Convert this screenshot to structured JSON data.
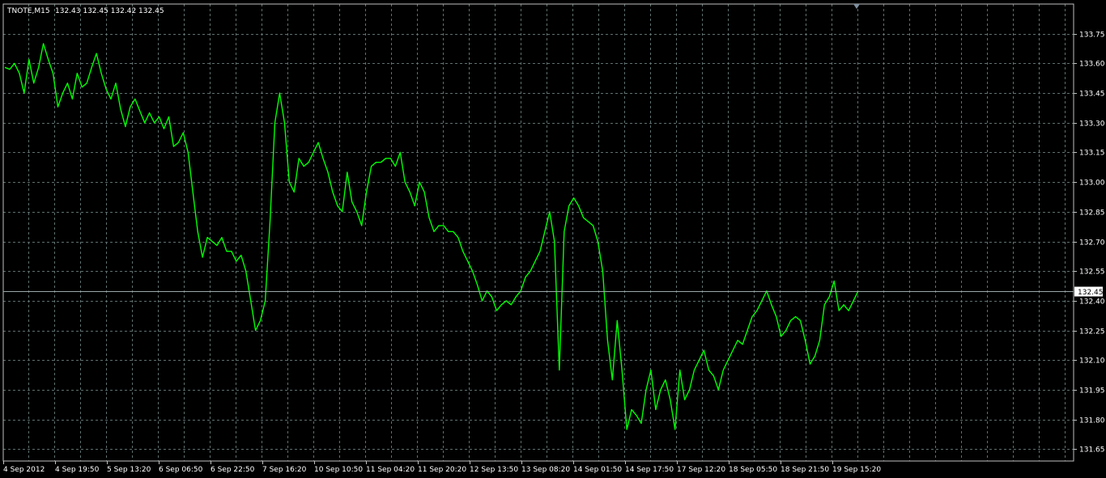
{
  "header": {
    "symbol_timeframe": "TNOTE,M15",
    "ohlc": "132.43 132.45 132.42 132.45"
  },
  "colors": {
    "background": "#000000",
    "grid": "#5f6f6f",
    "axis": "#c0c0c0",
    "price_line": "#00ff00",
    "current_price_line": "#9aa7a7",
    "current_price_label_bg": "#ffffff",
    "current_price_label_text": "#000000",
    "text": "#ffffff"
  },
  "chart_data": {
    "type": "line",
    "symbol": "TNOTE",
    "timeframe": "M15",
    "ylim": [
      131.59,
      133.9
    ],
    "yticks": [
      131.65,
      131.8,
      131.95,
      132.1,
      132.25,
      132.4,
      132.55,
      132.7,
      132.85,
      133.0,
      133.15,
      133.3,
      133.45,
      133.6,
      133.75
    ],
    "ytick_labels": [
      "131.65",
      "131.80",
      "131.95",
      "132.10",
      "132.25",
      "132.40",
      "132.55",
      "132.70",
      "132.85",
      "133.00",
      "133.15",
      "133.30",
      "133.45",
      "133.60",
      "133.75"
    ],
    "xtick_labels": [
      "4 Sep 2012",
      "4 Sep 19:50",
      "5 Sep 13:20",
      "6 Sep 06:50",
      "6 Sep 22:50",
      "7 Sep 16:20",
      "10 Sep 10:50",
      "11 Sep 04:20",
      "11 Sep 20:20",
      "12 Sep 13:50",
      "13 Sep 08:20",
      "14 Sep 01:50",
      "14 Sep 17:50",
      "17 Sep 12:20",
      "18 Sep 05:50",
      "18 Sep 21:50",
      "19 Sep 15:20"
    ],
    "grid": true,
    "current_price": 132.45,
    "current_price_label": "132.45",
    "series": [
      {
        "values": [
          133.58,
          133.57,
          133.6,
          133.55,
          133.45,
          133.62,
          133.5,
          133.58,
          133.7,
          133.62,
          133.55,
          133.38,
          133.45,
          133.5,
          133.42,
          133.55,
          133.48,
          133.5,
          133.58,
          133.65,
          133.55,
          133.47,
          133.42,
          133.5,
          133.37,
          133.28,
          133.38,
          133.42,
          133.36,
          133.3,
          133.35,
          133.3,
          133.33,
          133.27,
          133.33,
          133.18,
          133.2,
          133.25,
          133.15,
          132.95,
          132.75,
          132.62,
          132.72,
          132.7,
          132.68,
          132.72,
          132.65,
          132.65,
          132.6,
          132.63,
          132.55,
          132.4,
          132.25,
          132.3,
          132.4,
          132.8,
          133.3,
          133.45,
          133.3,
          133.0,
          132.95,
          133.12,
          133.08,
          133.1,
          133.15,
          133.2,
          133.12,
          133.05,
          132.95,
          132.88,
          132.85,
          133.05,
          132.9,
          132.85,
          132.78,
          132.95,
          133.08,
          133.1,
          133.1,
          133.12,
          133.12,
          133.08,
          133.15,
          133.0,
          132.95,
          132.88,
          133.0,
          132.95,
          132.82,
          132.75,
          132.78,
          132.78,
          132.75,
          132.75,
          132.72,
          132.65,
          132.6,
          132.55,
          132.48,
          132.4,
          132.45,
          132.42,
          132.35,
          132.38,
          132.4,
          132.38,
          132.42,
          132.45,
          132.52,
          132.55,
          132.6,
          132.65,
          132.75,
          132.85,
          132.7,
          132.05,
          132.75,
          132.88,
          132.92,
          132.88,
          132.82,
          132.8,
          132.78,
          132.7,
          132.55,
          132.2,
          132.0,
          132.3,
          132.05,
          131.75,
          131.85,
          131.82,
          131.78,
          131.95,
          132.05,
          131.85,
          131.95,
          132.0,
          131.9,
          131.75,
          132.05,
          131.9,
          131.95,
          132.05,
          132.1,
          132.15,
          132.05,
          132.02,
          131.95,
          132.05,
          132.1,
          132.15,
          132.2,
          132.18,
          132.25,
          132.32,
          132.35,
          132.4,
          132.45,
          132.38,
          132.32,
          132.22,
          132.25,
          132.3,
          132.32,
          132.3,
          132.2,
          132.08,
          132.12,
          132.2,
          132.38,
          132.42,
          132.5,
          132.35,
          132.38,
          132.35,
          132.4,
          132.45
        ]
      }
    ]
  }
}
